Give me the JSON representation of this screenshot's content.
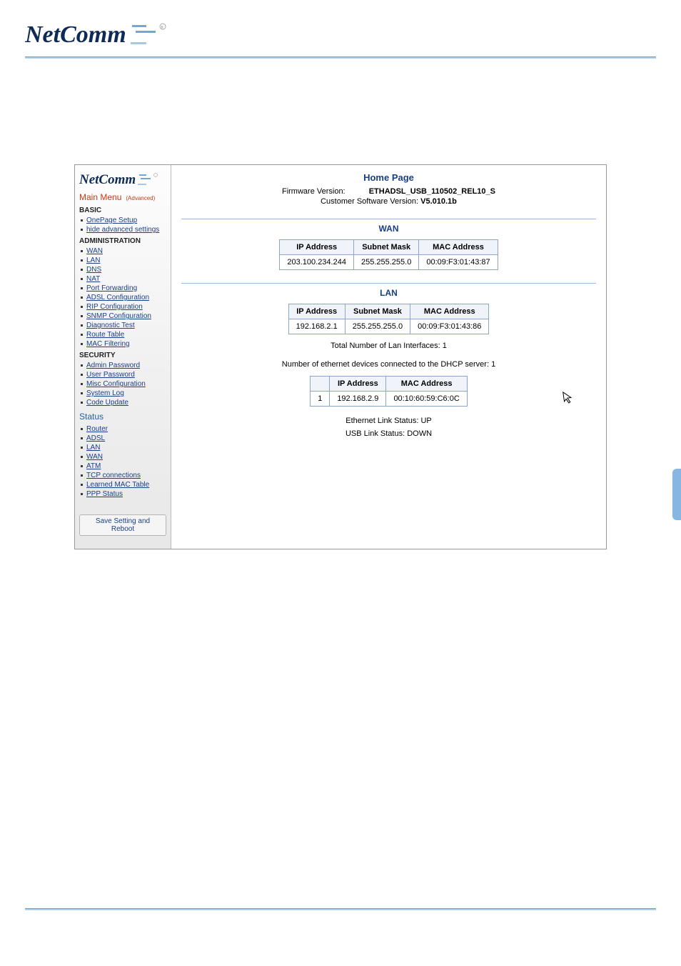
{
  "brand": "NetComm",
  "sidebar": {
    "main_menu_label": "Main Menu",
    "advanced_label": "(Advanced)",
    "sections": {
      "basic": {
        "title": "BASIC",
        "items": [
          "OnePage Setup",
          "hide advanced settings"
        ]
      },
      "administration": {
        "title": "ADMINISTRATION",
        "items": [
          "WAN",
          "LAN",
          "DNS",
          "NAT",
          "Port Forwarding",
          "ADSL Configuration",
          "RIP Configuration",
          "SNMP Configuration",
          "Diagnostic Test",
          "Route Table",
          "MAC Filtering"
        ]
      },
      "security": {
        "title": "SECURITY",
        "items": [
          "Admin Password",
          "User Password",
          "Misc Configuration",
          "System Log",
          "Code Update"
        ]
      },
      "status": {
        "title": "Status",
        "items": [
          "Router",
          "ADSL",
          "LAN",
          "WAN",
          "ATM",
          "TCP connections",
          "Learned MAC Table",
          "PPP Status"
        ]
      }
    },
    "save_button": "Save Setting and Reboot"
  },
  "home": {
    "title": "Home Page",
    "firmware_label": "Firmware Version:",
    "firmware_value": "ETHADSL_USB_110502_REL10_S",
    "csv_label": "Customer Software Version:",
    "csv_value": "V5.010.1b"
  },
  "wan": {
    "title": "WAN",
    "headers": [
      "IP Address",
      "Subnet Mask",
      "MAC Address"
    ],
    "row": [
      "203.100.234.244",
      "255.255.255.0",
      "00:09:F3:01:43:87"
    ]
  },
  "lan": {
    "title": "LAN",
    "headers": [
      "IP Address",
      "Subnet Mask",
      "MAC Address"
    ],
    "row": [
      "192.168.2.1",
      "255.255.255.0",
      "00:09:F3:01:43:86"
    ],
    "total_if_label": "Total Number of Lan Interfaces:",
    "total_if_value": "1",
    "dhcp_label": "Number of ethernet devices connected to the DHCP server:",
    "dhcp_value": "1",
    "dhcp_headers": [
      "",
      "IP Address",
      "MAC Address"
    ],
    "dhcp_row": [
      "1",
      "192.168.2.9",
      "00:10:60:59:C6:0C"
    ],
    "eth_status_label": "Ethernet Link Status:",
    "eth_status_value": "UP",
    "usb_status_label": "USB Link Status:",
    "usb_status_value": "DOWN"
  }
}
